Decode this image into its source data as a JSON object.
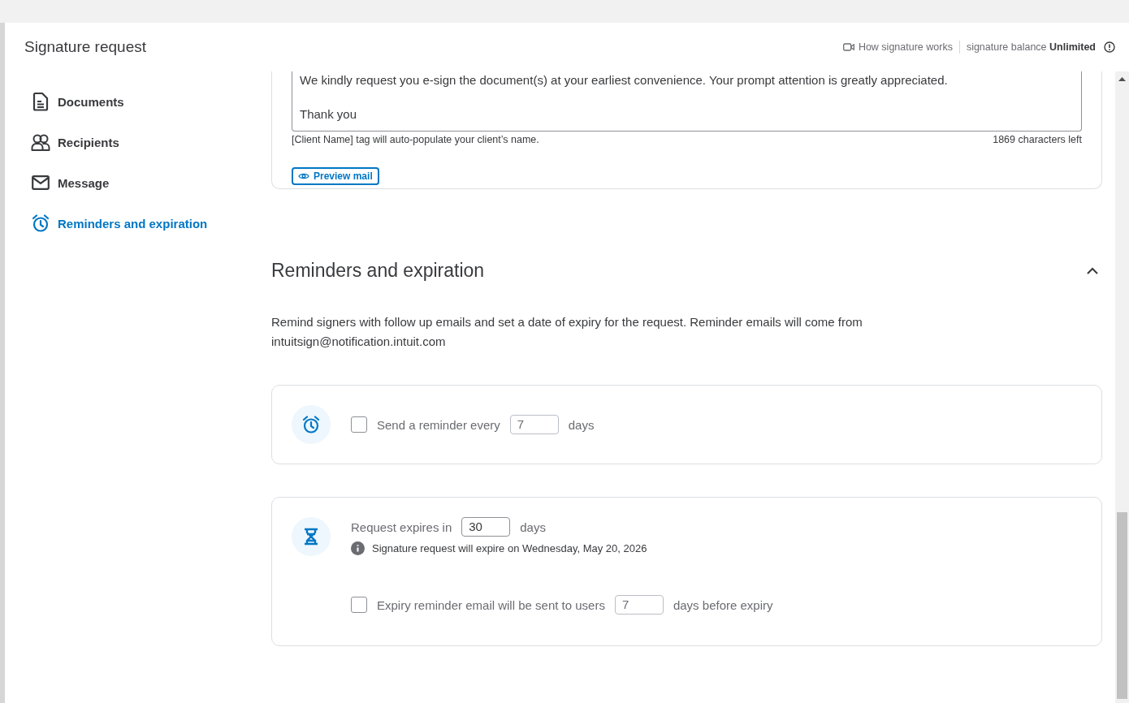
{
  "header": {
    "title": "Signature request",
    "help_link": "How signature works",
    "balance_label": "signature balance",
    "balance_value": "Unlimited"
  },
  "sidebar": {
    "items": [
      {
        "label": "Documents",
        "selected": false
      },
      {
        "label": "Recipients",
        "selected": false
      },
      {
        "label": "Message",
        "selected": false
      },
      {
        "label": "Reminders and expiration",
        "selected": true
      }
    ]
  },
  "message": {
    "lines": [
      "We kindly request you e-sign the document(s) at your earliest convenience. Your prompt attention is greatly appreciated.",
      "Thank you"
    ],
    "hint": "[Client Name] tag will auto-populate your client’s name.",
    "counter": "1869 characters left",
    "preview_button": "Preview mail"
  },
  "reminders": {
    "title": "Reminders and expiration",
    "expanded": true,
    "description": "Remind signers with follow up emails and set a date of expiry for the request. Reminder emails will come from intuitsign@notification.intuit.com",
    "reminder": {
      "checked": false,
      "label": "Send a reminder every",
      "value": "7",
      "unit": "days"
    },
    "expiry": {
      "label": "Request expires in",
      "value": "30",
      "unit": "days",
      "note": "Signature request will expire on Wednesday, May 20, 2026",
      "reminder": {
        "checked": false,
        "label": "Expiry reminder email will be sent to users",
        "value": "7",
        "unit": "days before expiry"
      }
    }
  }
}
